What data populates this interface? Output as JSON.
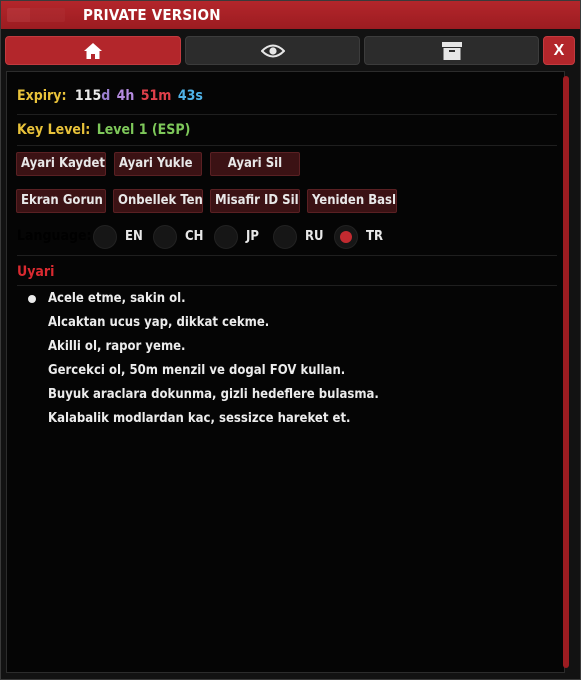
{
  "titlebar": {
    "title": "PRIVATE VERSION"
  },
  "tabs": [
    {
      "name": "home",
      "icon": "home-icon"
    },
    {
      "name": "visibility",
      "icon": "eye-icon"
    },
    {
      "name": "archive",
      "icon": "archive-icon"
    },
    {
      "name": "close",
      "label": "X"
    }
  ],
  "expiry": {
    "label": "Expiry:",
    "days": "115",
    "days_unit": "d",
    "hours": "4h",
    "minutes": "51m",
    "seconds": "43s"
  },
  "key_level": {
    "label": "Key Level:",
    "value": "Level 1 (ESP)"
  },
  "config_buttons": [
    "Ayari Kaydet",
    "Ayari Yukle",
    "Ayari Sil"
  ],
  "action_buttons": [
    "Ekran Gorun",
    "Onbellek Ten",
    "Misafir ID Sil",
    "Yeniden Basl"
  ],
  "language": {
    "label": "Language:",
    "options": [
      "EN",
      "CH",
      "JP",
      "RU",
      "TR"
    ],
    "selected": "TR"
  },
  "warning": {
    "title": "Uyari",
    "lines": [
      "Acele etme, sakin ol.",
      "Alcaktan ucus yap, dikkat cekme.",
      "Akilli ol, rapor yeme.",
      "Gercekci ol, 50m menzil ve dogal FOV kullan.",
      "Buyuk araclara dokunma, gizli hedeflere bulasma.",
      "Kalabalik modlardan kac, sessizce hareket et."
    ]
  },
  "colors": {
    "accent": "#b3262b",
    "expiry_label": "#e8c23a",
    "days": "#eaeaea",
    "days_unit": "#9b7fd0",
    "hours": "#b58be0",
    "minutes": "#e0404a",
    "seconds": "#4fb3e8",
    "key_level_label": "#e8c23a",
    "key_level_value": "#7ec85a",
    "warning_title": "#d92a30"
  }
}
